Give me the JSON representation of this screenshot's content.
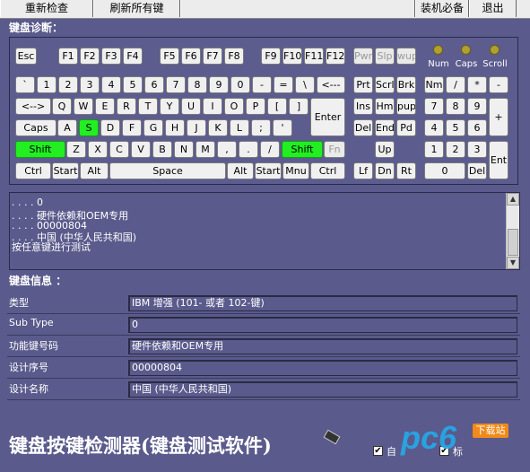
{
  "toolbar": {
    "recheck": "重新检查",
    "refresh_all": "刷新所有键",
    "install_must": "装机必备",
    "exit": "退出"
  },
  "sections": {
    "keyboard_diag": "键盘诊断：",
    "keyboard_info": "键盘信息 ："
  },
  "keyboard": {
    "keys": {
      "esc": "Esc",
      "f1": "F1",
      "f2": "F2",
      "f3": "F3",
      "f4": "F4",
      "f5": "F5",
      "f6": "F6",
      "f7": "F7",
      "f8": "F8",
      "f9": "F9",
      "f10": "F10",
      "f11": "F11",
      "f12": "F12",
      "pwr": "Pwr",
      "slp": "Slp",
      "wup": "wup",
      "backtick": "`",
      "n1": "1",
      "n2": "2",
      "n3": "3",
      "n4": "4",
      "n5": "5",
      "n6": "6",
      "n7": "7",
      "n8": "8",
      "n9": "9",
      "n0": "0",
      "minus": "-",
      "equal": "=",
      "backslash": "\\",
      "backspace": "<---",
      "tab": "<-->",
      "q": "Q",
      "w": "W",
      "e": "E",
      "r": "R",
      "t": "T",
      "y": "Y",
      "u": "U",
      "i": "I",
      "o": "O",
      "p": "P",
      "lbracket": "[",
      "rbracket": "]",
      "enter": "Enter",
      "caps": "Caps",
      "a": "A",
      "s": "S",
      "d": "D",
      "f": "F",
      "g": "G",
      "h": "H",
      "j": "J",
      "k": "K",
      "l": "L",
      "semicolon": ";",
      "quote": "'",
      "lshift": "Shift",
      "z": "Z",
      "x": "X",
      "c": "C",
      "v": "V",
      "b": "B",
      "n": "N",
      "m": "M",
      "comma": ",",
      "period": ".",
      "slash": "/",
      "rshift": "Shift",
      "fn": "Fn",
      "lctrl": "Ctrl",
      "lstart": "Start",
      "lalt": "Alt",
      "space": "Space",
      "ralt": "Alt",
      "rstart": "Start",
      "mnu": "Mnu",
      "rctrl": "Ctrl",
      "prt": "Prt",
      "scrl": "Scrl",
      "brk": "Brk",
      "ins": "Ins",
      "hm": "Hm",
      "pup": "pup",
      "del": "Del",
      "end": "End",
      "pd": "Pd",
      "up": "Up",
      "left": "Lf",
      "down": "Dn",
      "right": "Rt",
      "nm": "Nm",
      "kdiv": "/",
      "kmul": "*",
      "ksub": "-",
      "k7": "7",
      "k8": "8",
      "k9": "9",
      "kadd": "+",
      "k4": "4",
      "k5": "5",
      "k6": "6",
      "k1": "1",
      "k2": "2",
      "k3": "3",
      "kent": "Ent",
      "k0": "0",
      "kdel": "Del"
    },
    "pressed": [
      "s",
      "lshift",
      "rshift"
    ],
    "disabled": [
      "pwr",
      "slp",
      "wup",
      "fn"
    ],
    "leds": {
      "num": "Num",
      "caps": "Caps",
      "scroll": "Scroll"
    }
  },
  "log": {
    "lines": [
      ". . . .  0",
      ". . . .  硬件依赖和OEM专用",
      ". . . .  00000804",
      ". . . .  中国 (中华人民共和国)",
      "按任意键进行测试"
    ]
  },
  "info": {
    "type_label": "类型",
    "type_value": "IBM 增强 (101- 或者 102-键)",
    "subtype_label": "Sub Type",
    "subtype_value": "0",
    "func_label": "功能键号码",
    "func_value": "硬件依赖和OEM专用",
    "serial_label": "设计序号",
    "serial_value": "00000804",
    "name_label": "设计名称",
    "name_value": "中国 (中华人民共和国)"
  },
  "footer": {
    "title": "键盘按键检测器(键盘测试软件)",
    "check1_label": "自",
    "check2_label": "标",
    "check1_checked": true,
    "check2_checked": true
  },
  "watermark": {
    "text": "pc6",
    "sub": "下载站"
  }
}
